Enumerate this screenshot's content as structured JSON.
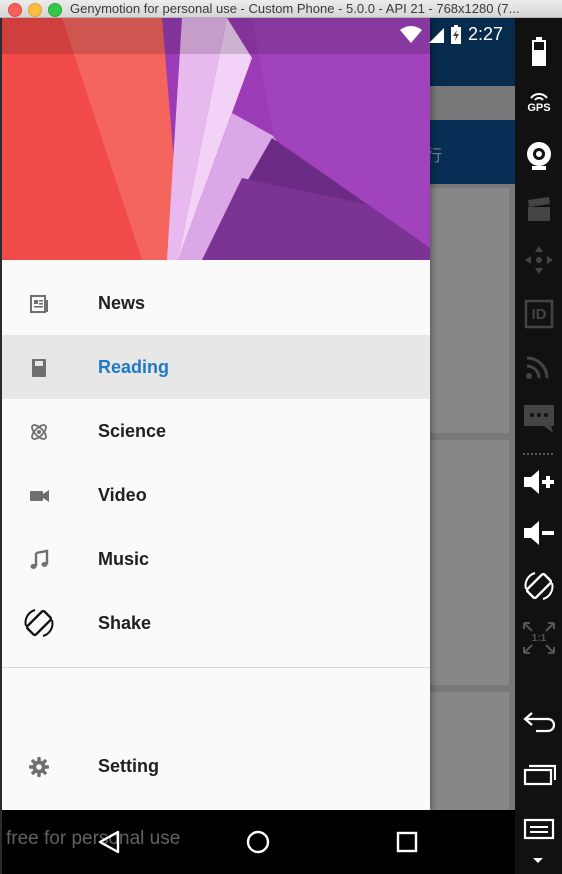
{
  "window": {
    "title": "Genymotion for personal use - Custom Phone - 5.0.0 - API 21 - 768x1280 (7..."
  },
  "statusbar": {
    "time": "2:27"
  },
  "background_app": {
    "tab_label": "排行"
  },
  "drawer": {
    "menu": [
      {
        "label": "News",
        "icon": "newspaper-icon"
      },
      {
        "label": "Reading",
        "icon": "book-icon",
        "active": true
      },
      {
        "label": "Science",
        "icon": "atom-icon"
      },
      {
        "label": "Video",
        "icon": "videocam-icon"
      },
      {
        "label": "Music",
        "icon": "music-note-icon"
      },
      {
        "label": "Shake",
        "icon": "screen-rotation-icon"
      }
    ],
    "setting": {
      "label": "Setting",
      "icon": "gear-icon"
    },
    "colors": {
      "active": "#1f78c8",
      "header_purple": "#9b3bb5",
      "header_red": "#f0524e"
    }
  },
  "watermark": "free for personal use",
  "sidebar": {
    "items": [
      "battery-icon",
      "gps-icon",
      "webcam-icon",
      "clapperboard-icon",
      "dpad-icon",
      "id-icon",
      "cast-icon",
      "sms-icon",
      "volume-up-icon",
      "volume-down-icon",
      "rotate-icon",
      "scale-icon",
      "back-icon",
      "recent-apps-icon",
      "menu-icon"
    ],
    "gps_label": "GPS",
    "id_label": "ID",
    "scale_label": "1:1"
  }
}
